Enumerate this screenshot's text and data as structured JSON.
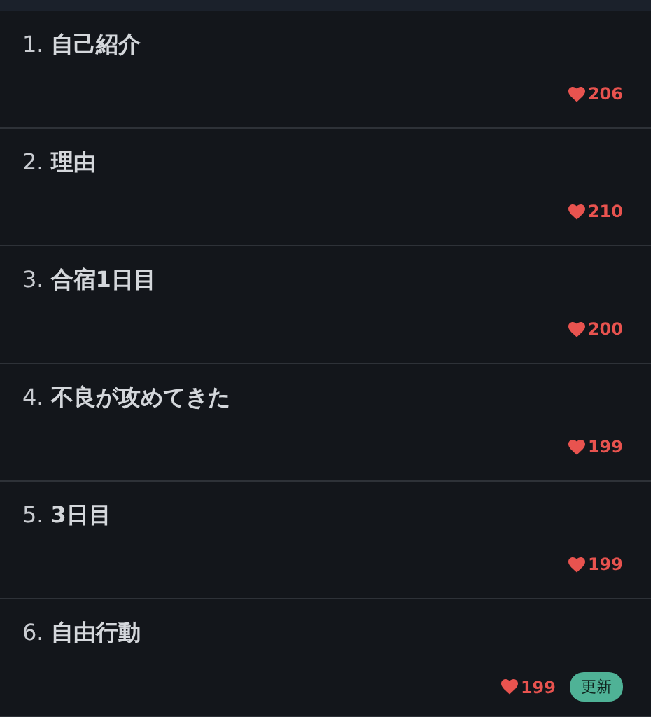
{
  "episodes": [
    {
      "number": "1.",
      "title": "自己紹介",
      "likes": "206"
    },
    {
      "number": "2.",
      "title": "理由",
      "likes": "210"
    },
    {
      "number": "3.",
      "title": "合宿1日目",
      "likes": "200"
    },
    {
      "number": "4.",
      "title": "不良が攻めてきた",
      "likes": "199"
    },
    {
      "number": "5.",
      "title": "3日目",
      "likes": "199"
    },
    {
      "number": "6.",
      "title": "自由行動",
      "likes": "199",
      "badge": "更新"
    }
  ]
}
